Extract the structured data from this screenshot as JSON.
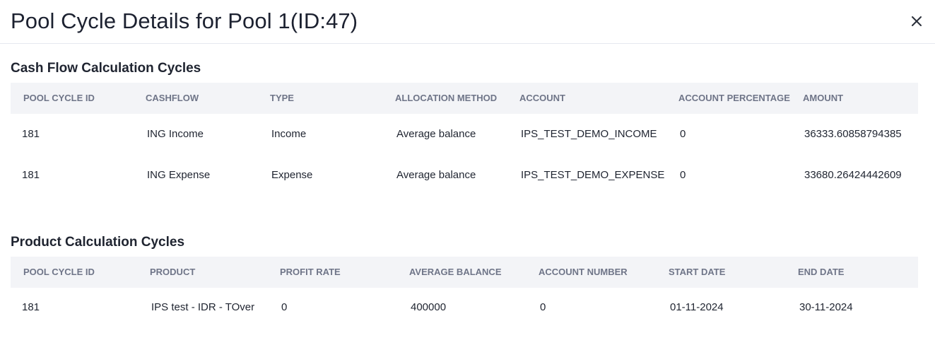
{
  "modal": {
    "title": "Pool Cycle Details for Pool 1(ID:47)"
  },
  "cashflow_section": {
    "title": "Cash Flow Calculation Cycles",
    "columns": [
      "POOL CYCLE ID",
      "CASHFLOW",
      "TYPE",
      "ALLOCATION METHOD",
      "ACCOUNT",
      "ACCOUNT PERCENTAGE",
      "AMOUNT"
    ],
    "rows": [
      [
        "181",
        "ING Income",
        "Income",
        "Average balance",
        "IPS_TEST_DEMO_INCOME",
        "0",
        "36333.60858794385"
      ],
      [
        "181",
        "ING Expense",
        "Expense",
        "Average balance",
        "IPS_TEST_DEMO_EXPENSE",
        "0",
        "33680.26424442609"
      ]
    ]
  },
  "product_section": {
    "title": "Product Calculation Cycles",
    "columns": [
      "POOL CYCLE ID",
      "PRODUCT",
      "PROFIT RATE",
      "AVERAGE BALANCE",
      "ACCOUNT NUMBER",
      "START DATE",
      "END DATE"
    ],
    "rows": [
      [
        "181",
        "IPS test - IDR - TOver",
        "0",
        "400000",
        "0",
        "01-11-2024",
        "30-11-2024"
      ]
    ]
  },
  "icons": {
    "close": "close-icon"
  }
}
